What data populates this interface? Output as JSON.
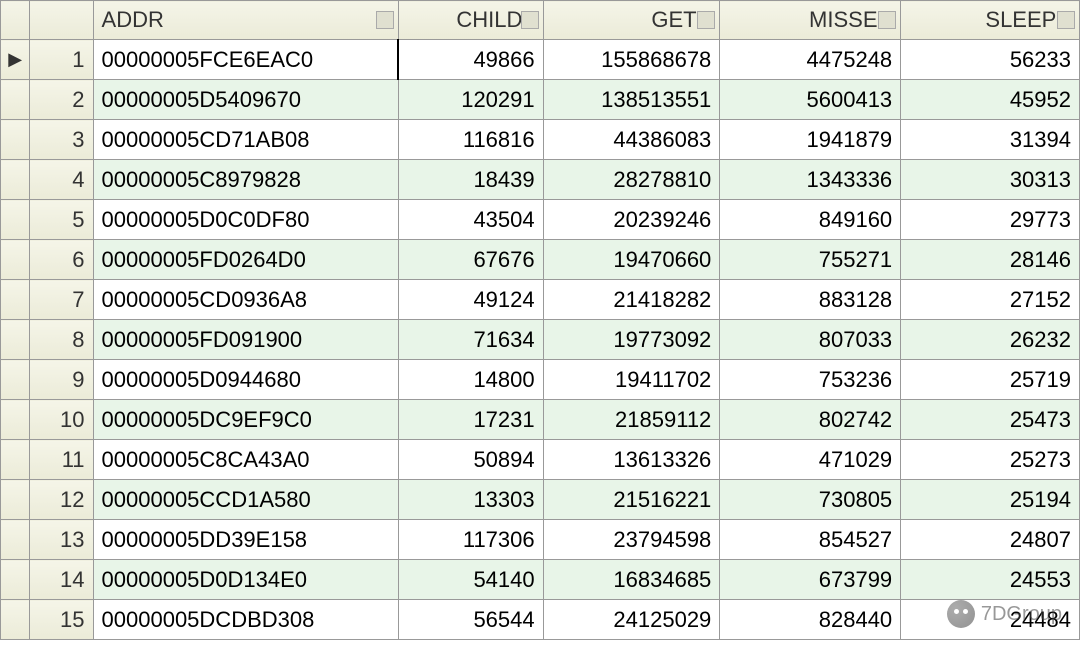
{
  "columns": {
    "addr": "ADDR",
    "child": "CHILD#",
    "gets": "GETS",
    "misses": "MISSES",
    "sleeps": "SLEEPS"
  },
  "active_row_index": 0,
  "watermark": "7DGroup",
  "rows": [
    {
      "n": "1",
      "addr": "00000005FCE6EAC0",
      "child": "49866",
      "gets": "155868678",
      "misses": "4475248",
      "sleeps": "56233"
    },
    {
      "n": "2",
      "addr": "00000005D5409670",
      "child": "120291",
      "gets": "138513551",
      "misses": "5600413",
      "sleeps": "45952"
    },
    {
      "n": "3",
      "addr": "00000005CD71AB08",
      "child": "116816",
      "gets": "44386083",
      "misses": "1941879",
      "sleeps": "31394"
    },
    {
      "n": "4",
      "addr": "00000005C8979828",
      "child": "18439",
      "gets": "28278810",
      "misses": "1343336",
      "sleeps": "30313"
    },
    {
      "n": "5",
      "addr": "00000005D0C0DF80",
      "child": "43504",
      "gets": "20239246",
      "misses": "849160",
      "sleeps": "29773"
    },
    {
      "n": "6",
      "addr": "00000005FD0264D0",
      "child": "67676",
      "gets": "19470660",
      "misses": "755271",
      "sleeps": "28146"
    },
    {
      "n": "7",
      "addr": "00000005CD0936A8",
      "child": "49124",
      "gets": "21418282",
      "misses": "883128",
      "sleeps": "27152"
    },
    {
      "n": "8",
      "addr": "00000005FD091900",
      "child": "71634",
      "gets": "19773092",
      "misses": "807033",
      "sleeps": "26232"
    },
    {
      "n": "9",
      "addr": "00000005D0944680",
      "child": "14800",
      "gets": "19411702",
      "misses": "753236",
      "sleeps": "25719"
    },
    {
      "n": "10",
      "addr": "00000005DC9EF9C0",
      "child": "17231",
      "gets": "21859112",
      "misses": "802742",
      "sleeps": "25473"
    },
    {
      "n": "11",
      "addr": "00000005C8CA43A0",
      "child": "50894",
      "gets": "13613326",
      "misses": "471029",
      "sleeps": "25273"
    },
    {
      "n": "12",
      "addr": "00000005CCD1A580",
      "child": "13303",
      "gets": "21516221",
      "misses": "730805",
      "sleeps": "25194"
    },
    {
      "n": "13",
      "addr": "00000005DD39E158",
      "child": "117306",
      "gets": "23794598",
      "misses": "854527",
      "sleeps": "24807"
    },
    {
      "n": "14",
      "addr": "00000005D0D134E0",
      "child": "54140",
      "gets": "16834685",
      "misses": "673799",
      "sleeps": "24553"
    },
    {
      "n": "15",
      "addr": "00000005DCDBD308",
      "child": "56544",
      "gets": "24125029",
      "misses": "828440",
      "sleeps": "24484"
    }
  ]
}
